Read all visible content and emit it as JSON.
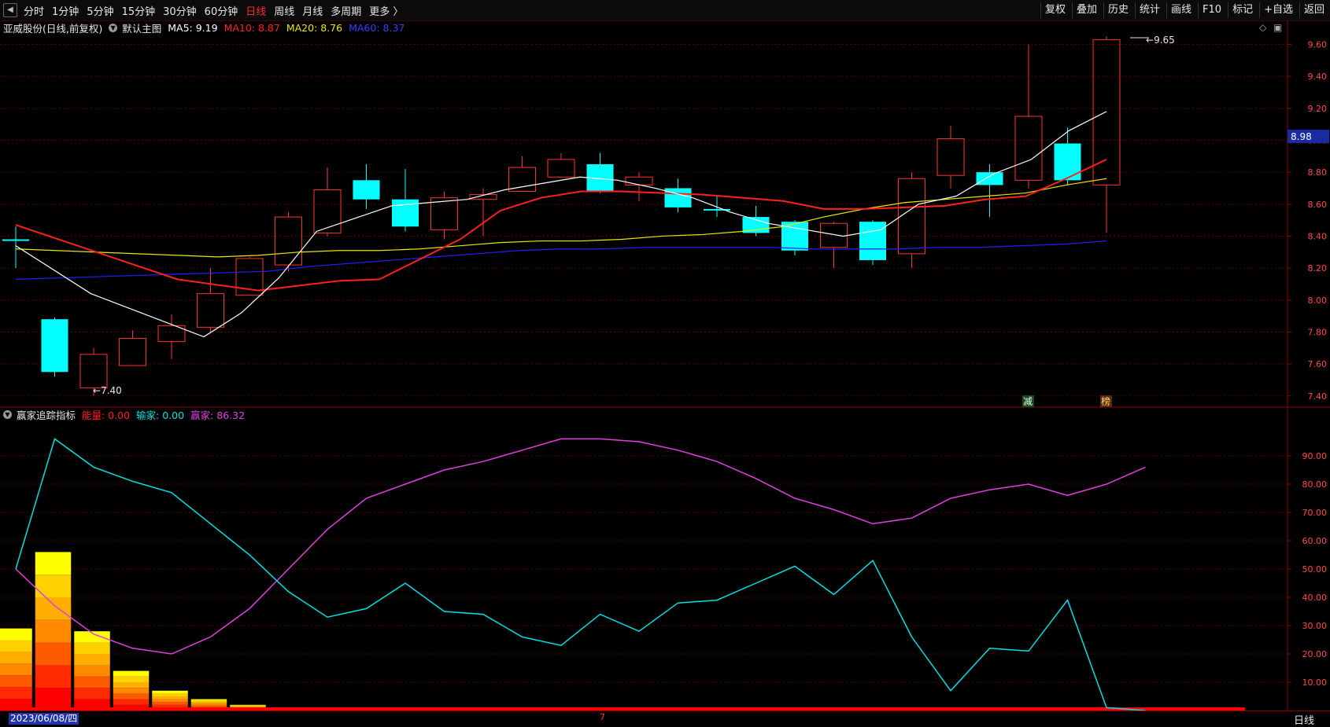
{
  "toolbar": {
    "back_icon": "back-arrow-icon",
    "periods": [
      "分时",
      "1分钟",
      "5分钟",
      "15分钟",
      "30分钟",
      "60分钟",
      "日线",
      "周线",
      "月线",
      "多周期",
      "更多 〉"
    ],
    "active_period": "日线",
    "right_tools": [
      "复权",
      "叠加",
      "历史",
      "统计",
      "画线",
      "F10",
      "标记",
      "+自选",
      "返回"
    ]
  },
  "main_legend": {
    "stock": "亚威股份(日线,前复权)",
    "template": "默认主图",
    "ma5": "MA5: 9.19",
    "ma10": "MA10: 8.87",
    "ma20": "MA20: 8.76",
    "ma60": "MA60: 8.37",
    "colors": {
      "ma5": "#ffffff",
      "ma10": "#ff2020",
      "ma20": "#e8e800",
      "ma60": "#2020ff"
    }
  },
  "sub_legend": {
    "name": "赢家追踪指标",
    "energy": "能量: 0.00",
    "loser": "输家: 0.00",
    "winner": "赢家: 86.32",
    "colors": {
      "energy": "#ff2020",
      "loser": "#00e0e0",
      "winner": "#e040e0"
    }
  },
  "annotations": {
    "max": "9.65",
    "min": "7.40",
    "current_price": "8.98",
    "tag_jian": "减",
    "tag_bang": "榜",
    "mid_marker": "7"
  },
  "bottom": {
    "date": "2023/06/08/四",
    "period": "日线"
  },
  "chart_data": [
    {
      "type": "candlestick",
      "y_ticks": [
        "9.60",
        "9.40",
        "9.20",
        "9.00",
        "8.80",
        "8.60",
        "8.40",
        "8.20",
        "8.00",
        "7.80",
        "7.60",
        "7.40"
      ],
      "ylim": [
        7.33,
        9.75
      ],
      "candles": [
        {
          "o": 8.38,
          "h": 8.46,
          "l": 8.2,
          "c": 8.38,
          "up": false
        },
        {
          "o": 7.88,
          "h": 7.89,
          "l": 7.52,
          "c": 7.55,
          "up": false
        },
        {
          "o": 7.45,
          "h": 7.7,
          "l": 7.4,
          "c": 7.66,
          "up": true
        },
        {
          "o": 7.59,
          "h": 7.81,
          "l": 7.59,
          "c": 7.76,
          "up": true
        },
        {
          "o": 7.74,
          "h": 7.91,
          "l": 7.63,
          "c": 7.84,
          "up": true
        },
        {
          "o": 7.83,
          "h": 8.2,
          "l": 7.8,
          "c": 8.04,
          "up": true
        },
        {
          "o": 8.03,
          "h": 8.27,
          "l": 8.03,
          "c": 8.26,
          "up": true
        },
        {
          "o": 8.22,
          "h": 8.55,
          "l": 8.18,
          "c": 8.52,
          "up": true
        },
        {
          "o": 8.42,
          "h": 8.83,
          "l": 8.4,
          "c": 8.69,
          "up": true
        },
        {
          "o": 8.75,
          "h": 8.85,
          "l": 8.57,
          "c": 8.63,
          "up": false
        },
        {
          "o": 8.63,
          "h": 8.82,
          "l": 8.43,
          "c": 8.46,
          "up": false
        },
        {
          "o": 8.44,
          "h": 8.68,
          "l": 8.38,
          "c": 8.64,
          "up": true
        },
        {
          "o": 8.63,
          "h": 8.7,
          "l": 8.4,
          "c": 8.66,
          "up": true
        },
        {
          "o": 8.68,
          "h": 8.9,
          "l": 8.68,
          "c": 8.83,
          "up": true
        },
        {
          "o": 8.77,
          "h": 8.92,
          "l": 8.77,
          "c": 8.88,
          "up": true
        },
        {
          "o": 8.85,
          "h": 8.92,
          "l": 8.67,
          "c": 8.68,
          "up": false
        },
        {
          "o": 8.72,
          "h": 8.8,
          "l": 8.62,
          "c": 8.77,
          "up": true
        },
        {
          "o": 8.7,
          "h": 8.76,
          "l": 8.55,
          "c": 8.58,
          "up": false
        },
        {
          "o": 8.57,
          "h": 8.65,
          "l": 8.52,
          "c": 8.57,
          "up": false
        },
        {
          "o": 8.52,
          "h": 8.59,
          "l": 8.4,
          "c": 8.42,
          "up": false
        },
        {
          "o": 8.49,
          "h": 8.5,
          "l": 8.28,
          "c": 8.31,
          "up": false
        },
        {
          "o": 8.33,
          "h": 8.49,
          "l": 8.2,
          "c": 8.48,
          "up": true
        },
        {
          "o": 8.49,
          "h": 8.5,
          "l": 8.22,
          "c": 8.25,
          "up": false
        },
        {
          "o": 8.29,
          "h": 8.8,
          "l": 8.2,
          "c": 8.76,
          "up": true
        },
        {
          "o": 8.78,
          "h": 9.09,
          "l": 8.7,
          "c": 9.01,
          "up": true
        },
        {
          "o": 8.8,
          "h": 8.85,
          "l": 8.52,
          "c": 8.72,
          "up": false
        },
        {
          "o": 8.75,
          "h": 9.6,
          "l": 8.7,
          "c": 9.15,
          "up": true
        },
        {
          "o": 8.98,
          "h": 9.08,
          "l": 8.72,
          "c": 8.75,
          "up": false
        },
        {
          "o": 8.72,
          "h": 9.65,
          "l": 8.42,
          "c": 9.63,
          "up": true
        }
      ],
      "ma5": [
        8.34,
        null,
        8.04,
        null,
        null,
        7.77,
        7.92,
        8.14,
        8.43,
        8.51,
        8.59,
        8.61,
        8.63,
        8.69,
        8.73,
        8.77,
        8.75,
        8.7,
        8.64,
        8.55,
        8.48,
        8.44,
        8.4,
        8.44,
        8.6,
        8.65,
        8.79,
        8.88,
        9.06,
        9.18
      ],
      "ma10": [
        8.47,
        null,
        null,
        null,
        8.13,
        null,
        8.06,
        8.09,
        8.12,
        8.13,
        null,
        8.38,
        8.56,
        8.64,
        8.68,
        8.68,
        8.67,
        8.66,
        8.64,
        8.62,
        8.57,
        8.57,
        8.58,
        8.59,
        8.63,
        8.65,
        8.76,
        8.88
      ],
      "ma20": [
        8.32,
        null,
        null,
        null,
        null,
        8.27,
        8.28,
        8.3,
        8.31,
        8.31,
        8.32,
        8.34,
        8.36,
        8.37,
        8.37,
        8.38,
        8.4,
        8.41,
        8.43,
        8.46,
        8.52,
        8.57,
        8.61,
        8.63,
        8.65,
        8.67,
        8.72,
        8.76
      ],
      "ma60": [
        8.13,
        null,
        null,
        null,
        null,
        null,
        8.18,
        8.21,
        8.23,
        8.25,
        8.27,
        8.29,
        8.31,
        8.32,
        8.32,
        8.33,
        8.33,
        8.33,
        8.33,
        8.32,
        8.32,
        8.32,
        8.33,
        8.33,
        8.34,
        8.35,
        8.37
      ]
    },
    {
      "type": "line",
      "title": "赢家追踪指标",
      "y_ticks": [
        "90.00",
        "80.00",
        "70.00",
        "60.00",
        "50.00",
        "40.00",
        "30.00",
        "20.00",
        "10.00"
      ],
      "ylim": [
        0,
        100
      ],
      "series": [
        {
          "name": "赢家",
          "values": [
            50,
            37,
            27,
            22,
            20,
            26,
            36,
            50,
            64,
            75,
            80,
            85,
            88,
            92,
            96,
            96,
            95,
            92,
            88,
            82,
            75,
            71,
            66,
            68,
            75,
            78,
            80,
            76,
            80,
            86
          ]
        },
        {
          "name": "输家",
          "values": [
            50,
            96,
            86,
            81,
            77,
            66,
            55,
            42,
            33,
            36,
            45,
            35,
            34,
            26,
            23,
            34,
            28,
            38,
            39,
            45,
            51,
            41,
            53,
            26,
            7,
            22,
            21,
            39,
            1,
            0
          ]
        },
        {
          "name": "能量",
          "values": [
            29,
            56,
            28,
            14,
            7,
            4,
            2,
            1,
            1,
            1,
            1,
            1,
            1,
            1,
            1,
            1,
            1,
            1,
            1,
            1,
            1,
            1,
            1,
            1,
            1,
            1,
            1,
            1,
            1,
            1
          ]
        }
      ]
    }
  ]
}
